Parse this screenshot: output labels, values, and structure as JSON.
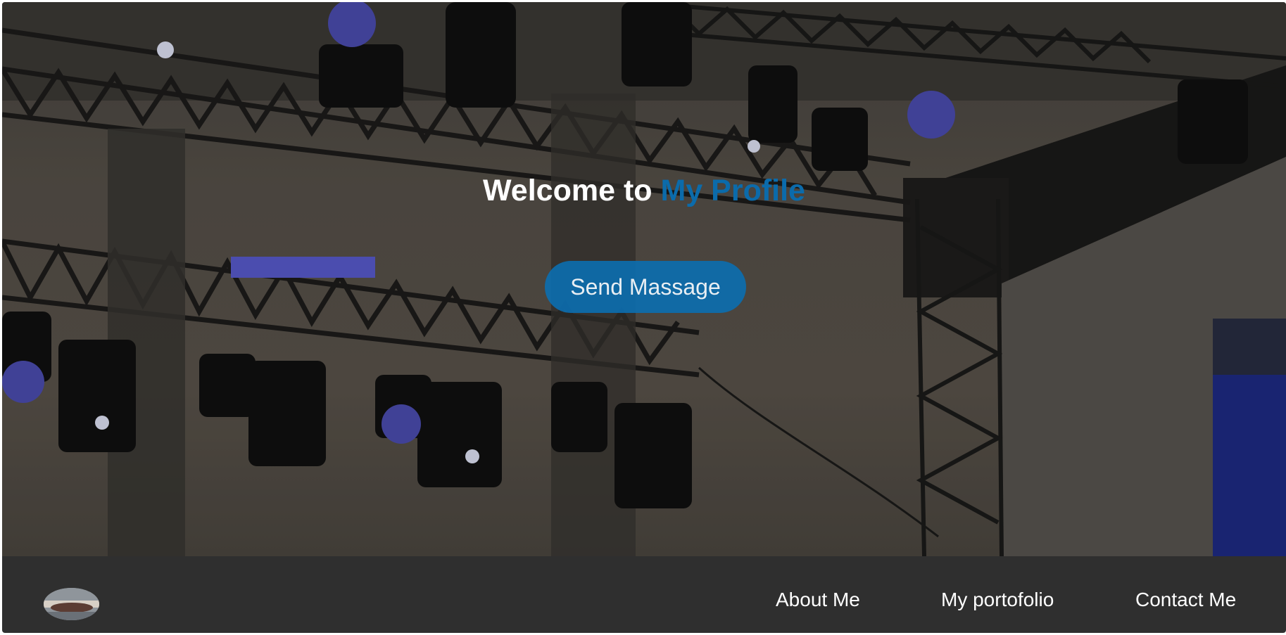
{
  "hero": {
    "title_prefix": "Welcome to ",
    "title_accent": "My Profile",
    "cta_label": "Send Massage",
    "background_image": "concert-stage-lighting-truss"
  },
  "navbar": {
    "logo_icon": "profile-avatar-logo",
    "links": [
      {
        "label": "About Me"
      },
      {
        "label": "My portofolio"
      },
      {
        "label": "Contact Me"
      }
    ]
  },
  "colors": {
    "accent": "#0b6bab",
    "button_bg": "#0b6eb0",
    "navbar_bg": "#2f2f2f",
    "text_light": "#ffffff"
  }
}
